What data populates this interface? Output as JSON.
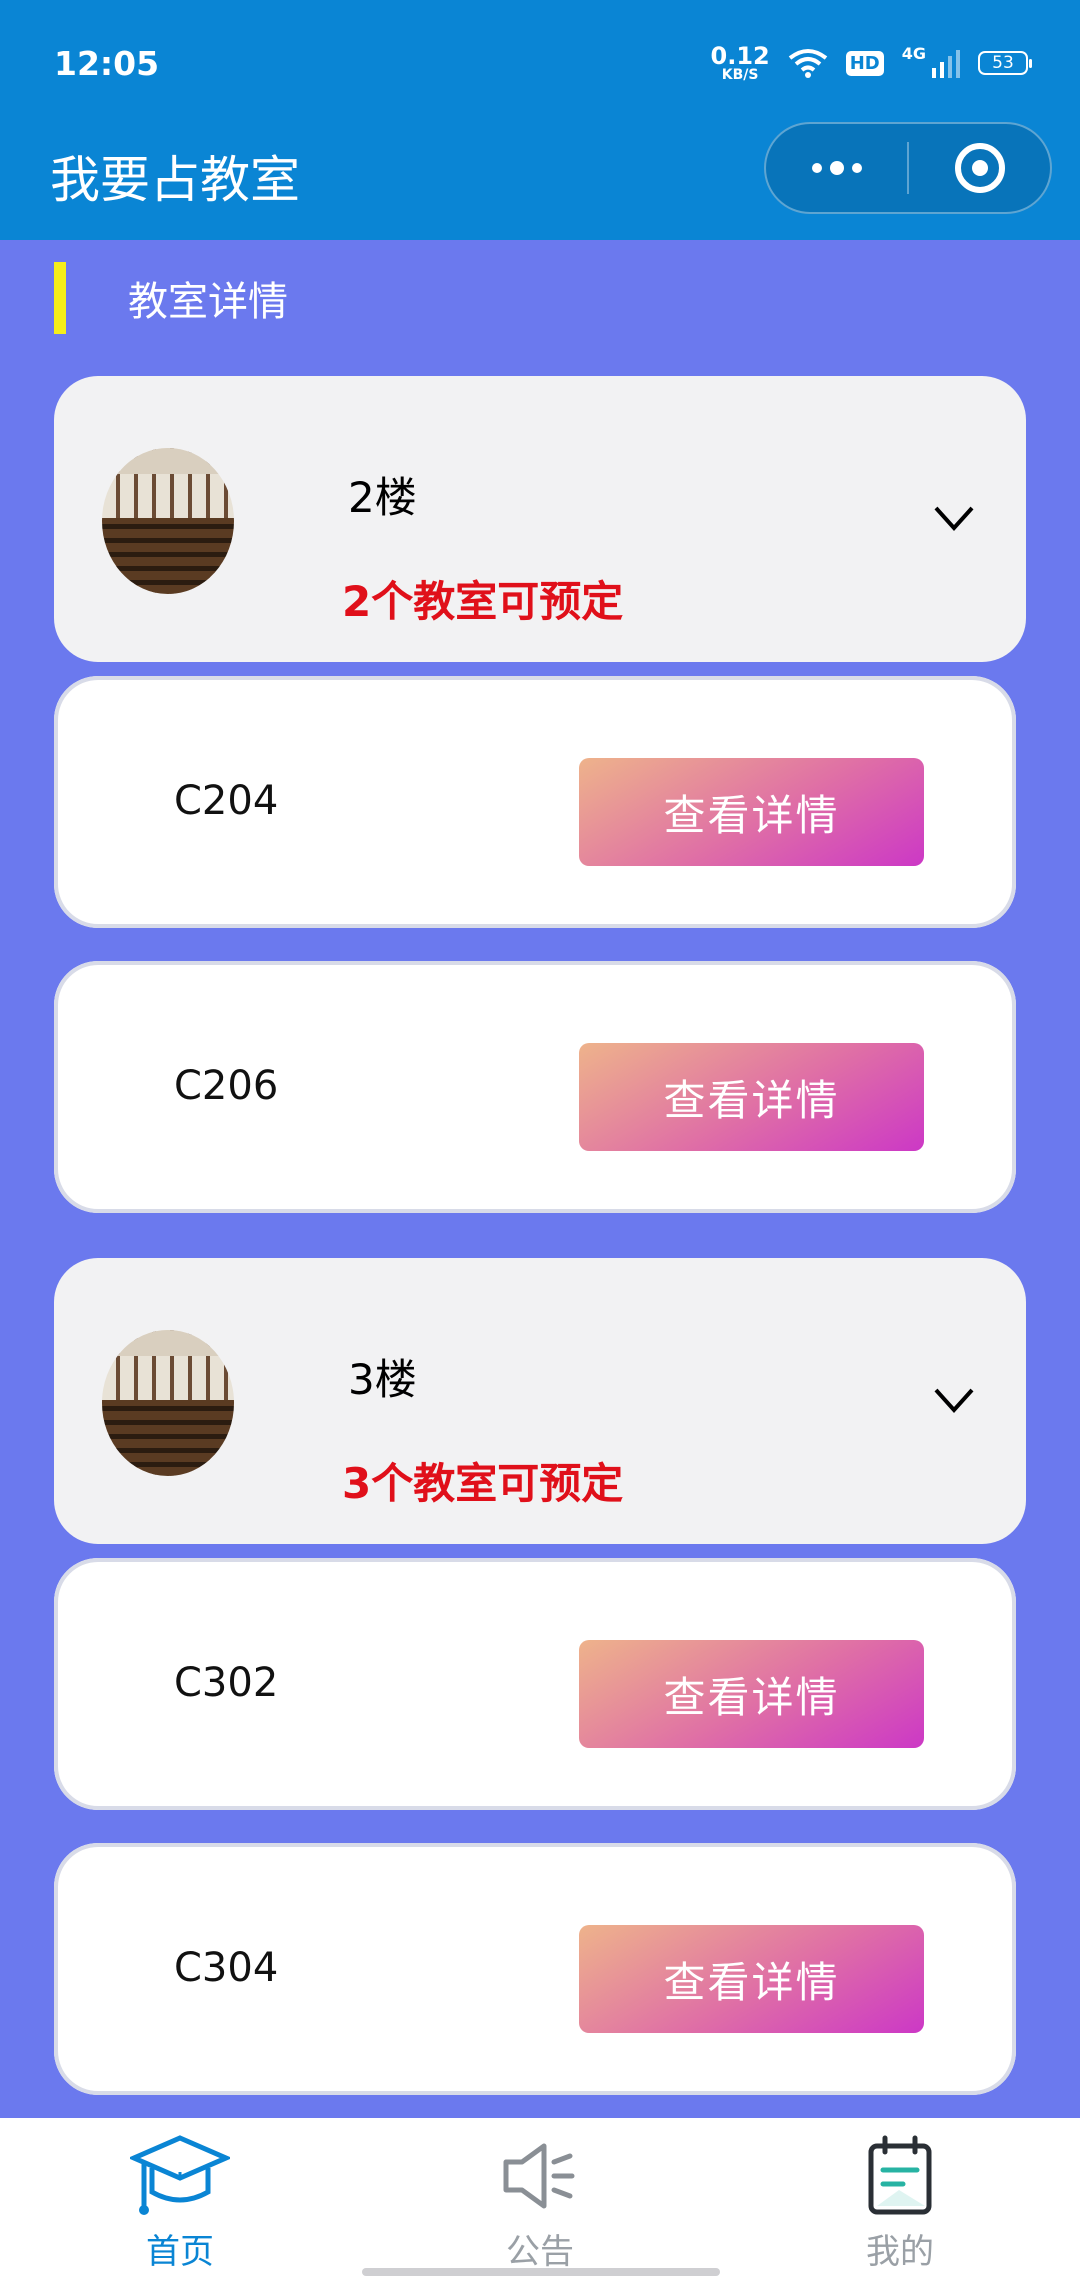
{
  "status_bar": {
    "time": "12:05",
    "net_speed_value": "0.12",
    "net_speed_unit": "KB/S",
    "hd": "HD",
    "network": "4G",
    "battery": "53"
  },
  "header": {
    "title": "我要占教室",
    "color": "#0a85d4"
  },
  "section": {
    "label": "教室详情",
    "accent_color": "#f4ee1a"
  },
  "floors": [
    {
      "name": "2楼",
      "available": "2个教室可预定",
      "rooms": [
        {
          "name": "C204",
          "action": "查看详情"
        },
        {
          "name": "C206",
          "action": "查看详情"
        }
      ]
    },
    {
      "name": "3楼",
      "available": "3个教室可预定",
      "rooms": [
        {
          "name": "C302",
          "action": "查看详情"
        },
        {
          "name": "C304",
          "action": "查看详情"
        }
      ]
    }
  ],
  "tabbar": {
    "items": [
      {
        "label": "首页",
        "icon": "graduation-cap-icon",
        "active": true
      },
      {
        "label": "公告",
        "icon": "megaphone-icon",
        "active": false
      },
      {
        "label": "我的",
        "icon": "notebook-icon",
        "active": false
      }
    ]
  },
  "colors": {
    "background": "#6b79ee",
    "available_text": "#e0101a",
    "button_gradient_start": "#eeb38b",
    "button_gradient_end": "#cc38c6"
  }
}
